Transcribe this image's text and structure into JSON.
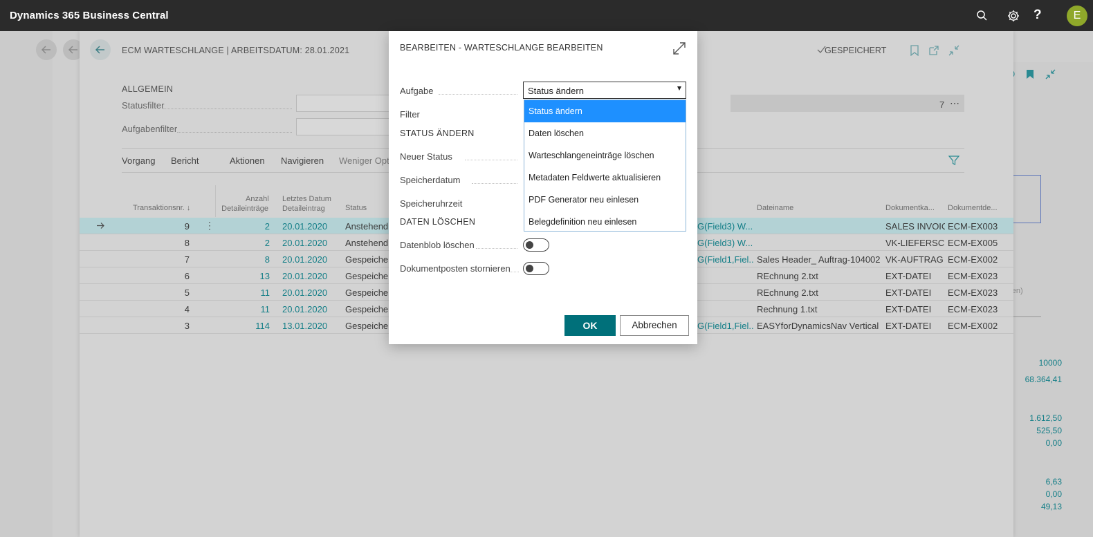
{
  "app": {
    "title": "Dynamics 365 Business Central",
    "avatar_initial": "E"
  },
  "topbar_icons": [
    "search-icon",
    "gear-icon",
    "help-icon"
  ],
  "page": {
    "title": "ECM WARTESCHLANGE | ARBEITSDATUM: 28.01.2021",
    "saved_label": "GESPEICHERT",
    "general_section": "ALLGEMEIN",
    "status_filter_label": "Statusfilter",
    "task_filter_label": "Aufgabenfilter",
    "count_value": "7",
    "actions": [
      "Vorgang",
      "Bericht",
      "Aktionen",
      "Navigieren",
      "Weniger Opt"
    ],
    "columns": {
      "transaktion": "Transaktionsnr. ↓",
      "anzahl_1": "Anzahl",
      "anzahl_2": "Detaileinträge",
      "datum_1": "Letztes Datum",
      "datum_2": "Detaileintrag",
      "status": "Status",
      "dateiname": "Dateiname",
      "dokumentart": "Dokumentka...",
      "dokumentdef": "Dokumentde..."
    },
    "rows": [
      {
        "nr": "9",
        "anzahl": "2",
        "datum": "20.01.2020",
        "status": "Anstehend",
        "filter": "G(Field3) W...",
        "dateiname": "",
        "art": "SALES INVOICE",
        "def": "ECM-EX003"
      },
      {
        "nr": "8",
        "anzahl": "2",
        "datum": "20.01.2020",
        "status": "Anstehend",
        "filter": "G(Field3) W...",
        "dateiname": "",
        "art": "VK-LIEFERSC...",
        "def": "ECM-EX005"
      },
      {
        "nr": "7",
        "anzahl": "8",
        "datum": "20.01.2020",
        "status": "Gespeicher",
        "filter": "G(Field1,Fiel...",
        "dateiname": "Sales Header_ Auftrag-104002....",
        "art": "VK-AUFTRAG",
        "def": "ECM-EX002"
      },
      {
        "nr": "6",
        "anzahl": "13",
        "datum": "20.01.2020",
        "status": "Gespeicher",
        "filter": "",
        "dateiname": "REchnung 2.txt",
        "art": "EXT-DATEI",
        "def": "ECM-EX023"
      },
      {
        "nr": "5",
        "anzahl": "11",
        "datum": "20.01.2020",
        "status": "Gespeicher",
        "filter": "",
        "dateiname": "REchnung 2.txt",
        "art": "EXT-DATEI",
        "def": "ECM-EX023"
      },
      {
        "nr": "4",
        "anzahl": "11",
        "datum": "20.01.2020",
        "status": "Gespeicher",
        "filter": "",
        "dateiname": "Rechnung 1.txt",
        "art": "EXT-DATEI",
        "def": "ECM-EX023"
      },
      {
        "nr": "3",
        "anzahl": "114",
        "datum": "13.01.2020",
        "status": "Gespeicher",
        "filter": "G(Field1,Fiel...",
        "dateiname": "EASYforDynamicsNav Vertical ...",
        "art": "EXT-DATEI",
        "def": "ECM-EX002"
      }
    ],
    "side_values": [
      "10000",
      "68.364,41",
      "1.612,50",
      "525,50",
      "0,00",
      "6,63",
      "0,00",
      "49,13"
    ],
    "side_text": "rden)"
  },
  "modal": {
    "title": "BEARBEITEN - WARTESCHLANGE BEARBEITEN",
    "aufgabe_label": "Aufgabe",
    "aufgabe_value": "Status ändern",
    "filter_label": "Filter",
    "section_status": "STATUS ÄNDERN",
    "neuer_status_label": "Neuer Status",
    "speicherdatum_label": "Speicherdatum",
    "speicheruhrzeit_label": "Speicheruhrzeit",
    "section_daten": "DATEN LÖSCHEN",
    "datenblob_label": "Datenblob löschen",
    "dokumentposten_label": "Dokumentposten stornieren",
    "ok_label": "OK",
    "cancel_label": "Abbrechen"
  },
  "dropdown": {
    "options": [
      "Status ändern",
      "Daten löschen",
      "Warteschlangeneinträge löschen",
      "Metadaten Feldwerte aktualisieren",
      "PDF Generator neu einlesen",
      "Belegdefinition neu einlesen"
    ],
    "selected_index": 0
  }
}
